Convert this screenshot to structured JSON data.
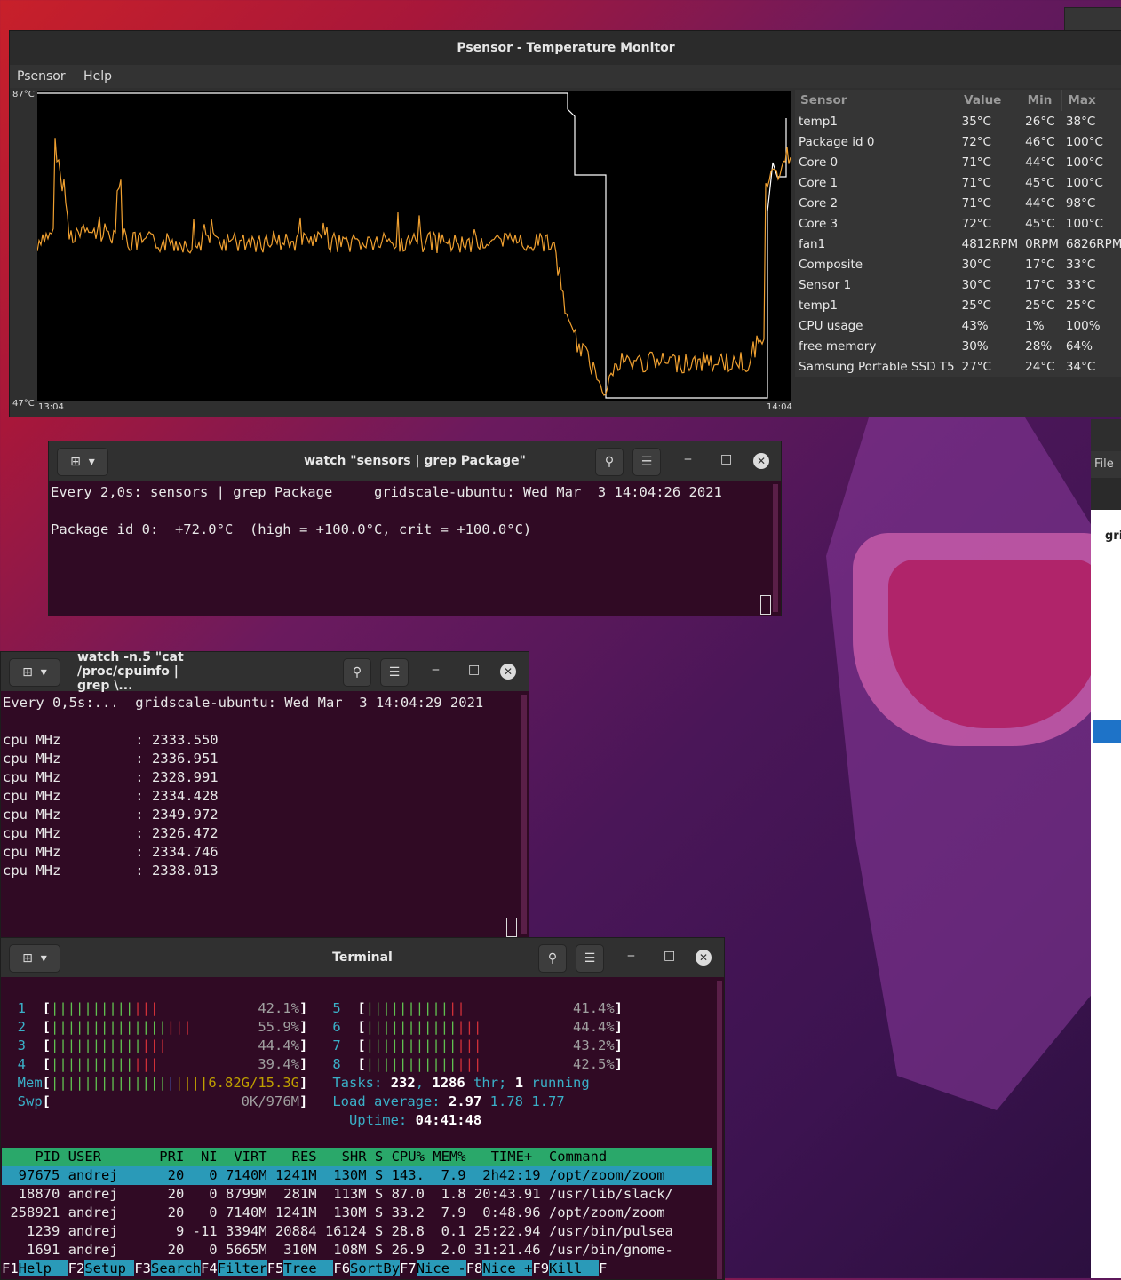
{
  "psensor": {
    "title": "Psensor - Temperature Monitor",
    "menu": [
      "Psensor",
      "Help"
    ],
    "graph": {
      "ymax": "87°C",
      "ymin": "47°C",
      "tstart": "13:04",
      "tend": "14:04"
    },
    "columns": [
      "Sensor",
      "Value",
      "Min",
      "Max"
    ],
    "rows": [
      [
        "temp1",
        "35°C",
        "26°C",
        "38°C"
      ],
      [
        "Package id 0",
        "72°C",
        "46°C",
        "100°C"
      ],
      [
        "Core 0",
        "71°C",
        "44°C",
        "100°C"
      ],
      [
        "Core 1",
        "71°C",
        "45°C",
        "100°C"
      ],
      [
        "Core 2",
        "71°C",
        "44°C",
        "98°C"
      ],
      [
        "Core 3",
        "72°C",
        "45°C",
        "100°C"
      ],
      [
        "fan1",
        "4812RPM",
        "0RPM",
        "6826RPM"
      ],
      [
        "Composite",
        "30°C",
        "17°C",
        "33°C"
      ],
      [
        "Sensor 1",
        "30°C",
        "17°C",
        "33°C"
      ],
      [
        "temp1",
        "25°C",
        "25°C",
        "25°C"
      ],
      [
        "CPU usage",
        "43%",
        "1%",
        "100%"
      ],
      [
        "free memory",
        "30%",
        "28%",
        "64%"
      ],
      [
        "Samsung Portable SSD T5",
        "27°C",
        "24°C",
        "34°C"
      ]
    ],
    "series_colors": {
      "orange": "#f0a030",
      "white": "#ffffff"
    }
  },
  "term1": {
    "title": "watch \"sensors | grep Package\"",
    "lines": [
      "Every 2,0s: sensors | grep Package     gridscale-ubuntu: Wed Mar  3 14:04:26 2021",
      "",
      "Package id 0:  +72.0°C  (high = +100.0°C, crit = +100.0°C)"
    ]
  },
  "term2": {
    "title": "watch -n.5 \"cat /proc/cpuinfo | grep \\...",
    "lines": [
      "Every 0,5s:...  gridscale-ubuntu: Wed Mar  3 14:04:29 2021",
      "",
      "cpu MHz         : 2333.550",
      "cpu MHz         : 2336.951",
      "cpu MHz         : 2328.991",
      "cpu MHz         : 2334.428",
      "cpu MHz         : 2349.972",
      "cpu MHz         : 2326.472",
      "cpu MHz         : 2334.746",
      "cpu MHz         : 2338.013"
    ]
  },
  "term3": {
    "title": "Terminal",
    "cpus_left": [
      {
        "n": "1",
        "g": "||||||||||",
        "r": "|||",
        "pct": "42.1%"
      },
      {
        "n": "2",
        "g": "||||||||||||||",
        "r": "|||",
        "pct": "55.9%"
      },
      {
        "n": "3",
        "g": "|||||||||||",
        "r": "|||",
        "pct": "44.4%"
      },
      {
        "n": "4",
        "g": "||||||||||",
        "r": "|||",
        "pct": "39.4%"
      }
    ],
    "cpus_right": [
      {
        "n": "5",
        "g": "||||||||||",
        "r": "||",
        "pct": "41.4%"
      },
      {
        "n": "6",
        "g": "|||||||||||",
        "r": "|||",
        "pct": "44.4%"
      },
      {
        "n": "7",
        "g": "|||||||||||",
        "r": "|||",
        "pct": "43.2%"
      },
      {
        "n": "8",
        "g": "|||||||||||",
        "r": "|||",
        "pct": "42.5%"
      }
    ],
    "mem": {
      "label": "Mem",
      "value": "6.82G/15.3G"
    },
    "swp": {
      "label": "Swp",
      "value": "0K/976M"
    },
    "tasks": {
      "label": "Tasks:",
      "tasks": "232",
      "thr": "1286",
      "thr_label": "thr;",
      "running": "1",
      "running_label": "running"
    },
    "load": {
      "label": "Load average:",
      "a": "2.97",
      "b": "1.78",
      "c": "1.77"
    },
    "uptime": {
      "label": "Uptime:",
      "value": "04:41:48"
    },
    "header": "    PID USER       PRI  NI  VIRT   RES   SHR S CPU% MEM%   TIME+  Command",
    "procs": [
      "  97675 andrej      20   0 7140M 1241M  130M S 143.  7.9  2h42:19 /opt/zoom/zoom",
      "  18870 andrej      20   0 8799M  281M  113M S 87.0  1.8 20:43.91 /usr/lib/slack/",
      " 258921 andrej      20   0 7140M 1241M  130M S 33.2  7.9  0:48.96 /opt/zoom/zoom",
      "   1239 andrej       9 -11 3394M 20884 16124 S 28.8  0.1 25:22.94 /usr/bin/pulsea",
      "   1691 andrej      20   0 5665M  310M  108M S 26.9  2.0 31:21.46 /usr/bin/gnome-"
    ],
    "fkeys": [
      [
        "F1",
        "Help  "
      ],
      [
        "F2",
        "Setup "
      ],
      [
        "F3",
        "Search"
      ],
      [
        "F4",
        "Filter"
      ],
      [
        "F5",
        "Tree  "
      ],
      [
        "F6",
        "SortBy"
      ],
      [
        "F7",
        "Nice -"
      ],
      [
        "F8",
        "Nice +"
      ],
      [
        "F9",
        "Kill  "
      ],
      [
        "F",
        ""
      ]
    ]
  },
  "right_window": {
    "menu_label": "File",
    "partial_text": "gri"
  }
}
